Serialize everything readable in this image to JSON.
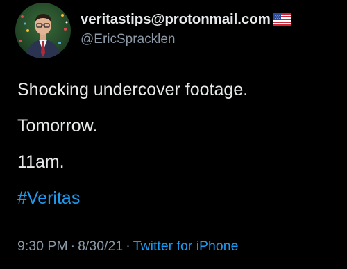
{
  "tweet": {
    "author": {
      "display_name": "veritastips@protonmail.com",
      "flag_emoji": "us-flag-icon",
      "handle": "@EricSpracklen"
    },
    "lines": [
      "Shocking undercover footage.",
      "Tomorrow.",
      "11am."
    ],
    "hashtag": "#Veritas",
    "meta": {
      "time": "9:30 PM",
      "separator": "·",
      "date": "8/30/21",
      "separator2": "·",
      "source": "Twitter for iPhone"
    }
  },
  "colors": {
    "background": "#000000",
    "text": "#e7e9ea",
    "secondary": "#8b98a5",
    "link": "#1d9bf0"
  }
}
